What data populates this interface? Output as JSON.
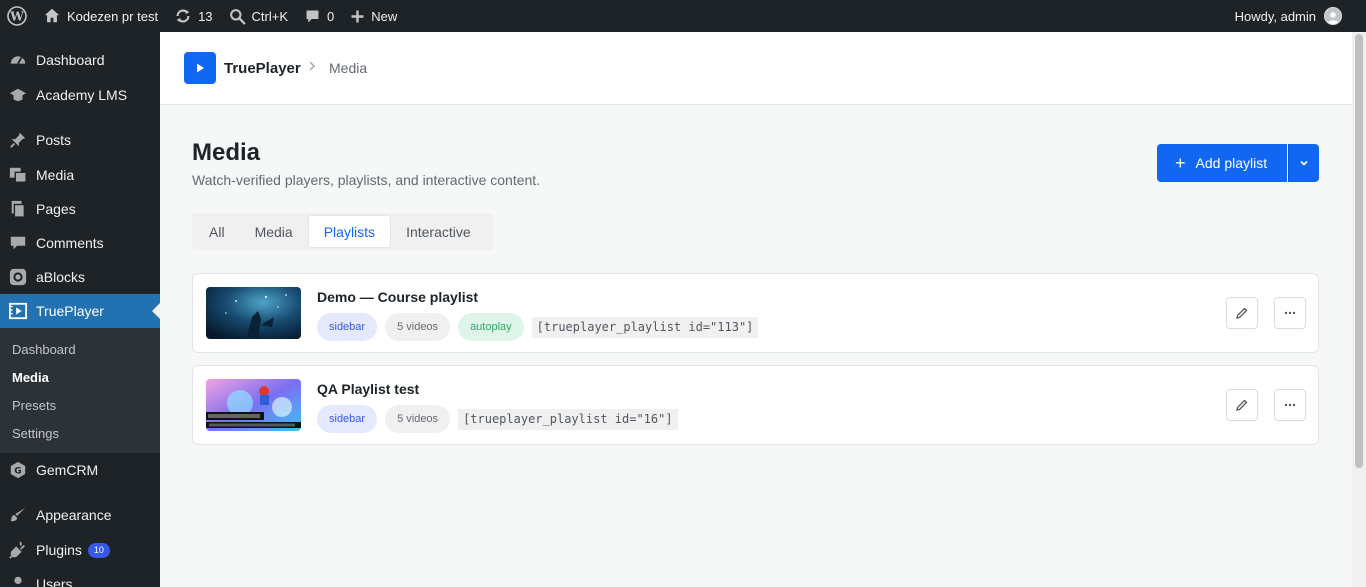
{
  "adminbar": {
    "site_name": "Kodezen pr test",
    "updates_count": "13",
    "search_shortcut": "Ctrl+K",
    "comments_count": "0",
    "new_label": "New",
    "greeting": "Howdy, admin"
  },
  "sidebar": {
    "items": [
      {
        "label": "Dashboard",
        "icon": "dashboard-icon"
      },
      {
        "label": "Academy LMS",
        "icon": "graduation-cap-icon"
      },
      {
        "label": "Posts",
        "icon": "pin-icon"
      },
      {
        "label": "Media",
        "icon": "media-icon"
      },
      {
        "label": "Pages",
        "icon": "pages-icon"
      },
      {
        "label": "Comments",
        "icon": "comment-icon"
      },
      {
        "label": "aBlocks",
        "icon": "ablocks-icon"
      },
      {
        "label": "TruePlayer",
        "icon": "video-icon"
      },
      {
        "label": "GemCRM",
        "icon": "gemcrm-icon"
      },
      {
        "label": "Appearance",
        "icon": "brush-icon"
      },
      {
        "label": "Plugins",
        "icon": "plugin-icon",
        "badge": "10"
      },
      {
        "label": "Users",
        "icon": "users-icon"
      }
    ],
    "submenu": [
      "Dashboard",
      "Media",
      "Presets",
      "Settings"
    ]
  },
  "header": {
    "brand": "TruePlayer",
    "crumb": "Media"
  },
  "page": {
    "title": "Media",
    "subtitle": "Watch-verified players, playlists, and interactive content.",
    "add_label": "Add playlist"
  },
  "tabs": [
    "All",
    "Media",
    "Playlists",
    "Interactive"
  ],
  "active_tab": "Playlists",
  "playlists": [
    {
      "title": "Demo — Course playlist",
      "layout": "sidebar",
      "count": "5 videos",
      "autoplay": "autoplay",
      "shortcode": "[trueplayer_playlist id=\"113\"]"
    },
    {
      "title": "QA Playlist test",
      "layout": "sidebar",
      "count": "5 videos",
      "shortcode": "[trueplayer_playlist id=\"16\"]"
    }
  ],
  "colors": {
    "accent": "#1167f2",
    "wp_admin_bg": "#1d2327",
    "wp_active": "#2271b1"
  }
}
